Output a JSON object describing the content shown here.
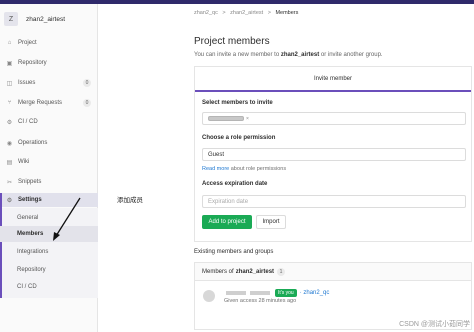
{
  "project": {
    "avatar_letter": "Z",
    "name": "zhan2_airtest"
  },
  "sidebar": {
    "items": [
      {
        "icon": "project-icon",
        "glyph": "⌂",
        "label": "Project"
      },
      {
        "icon": "repository-icon",
        "glyph": "▣",
        "label": "Repository"
      },
      {
        "icon": "issues-icon",
        "glyph": "◫",
        "label": "Issues",
        "badge": "0"
      },
      {
        "icon": "merge-requests-icon",
        "glyph": "⑂",
        "label": "Merge Requests",
        "badge": "0"
      },
      {
        "icon": "ci-cd-icon",
        "glyph": "⚙",
        "label": "CI / CD"
      },
      {
        "icon": "operations-icon",
        "glyph": "◉",
        "label": "Operations"
      },
      {
        "icon": "wiki-icon",
        "glyph": "▤",
        "label": "Wiki"
      },
      {
        "icon": "snippets-icon",
        "glyph": "✂",
        "label": "Snippets"
      },
      {
        "icon": "settings-icon",
        "glyph": "⚙",
        "label": "Settings"
      }
    ],
    "settings_sub": [
      "General",
      "Members",
      "Integrations",
      "Repository",
      "CI / CD"
    ]
  },
  "annotation": {
    "text": "添加成员"
  },
  "breadcrumb": {
    "group": "zhan2_qc",
    "project": "zhan2_airtest",
    "current": "Members",
    "separator": ">"
  },
  "page": {
    "title": "Project members",
    "desc_pre": "You can invite a new member to",
    "desc_project": "zhan2_airtest",
    "desc_post": "or invite another group."
  },
  "invite": {
    "tab_label": "Invite member",
    "select_label": "Select members to invite",
    "role_label": "Choose a role permission",
    "role_value": "Guest",
    "read_more_link": "Read more",
    "read_more_rest": "about role permissions",
    "expiration_label": "Access expiration date",
    "expiration_placeholder": "Expiration date",
    "add_button": "Add to project",
    "import_button": "Import"
  },
  "existing": {
    "heading": "Existing members and groups",
    "members_of": "Members of",
    "project": "zhan2_airtest",
    "count": "1",
    "its_you": "It's you",
    "username_link": "· zhan2_qc",
    "granted": "Given access 28 minutes ago"
  },
  "watermark": "CSDN @测试小茹同学",
  "colors": {
    "accent": "#6b4fbb",
    "green": "#1aaa55",
    "link": "#1f78d1",
    "topbar": "#2f2a6b"
  }
}
